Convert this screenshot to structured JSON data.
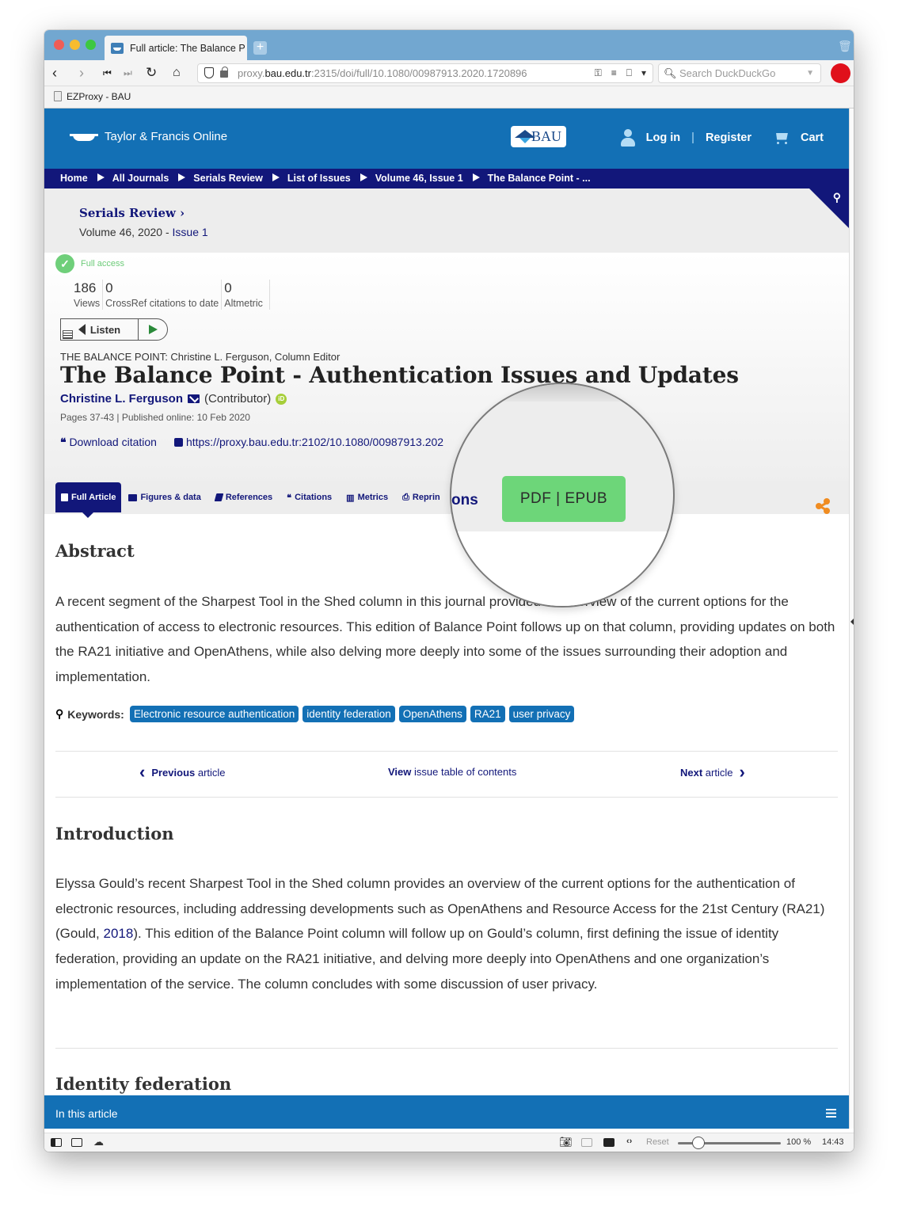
{
  "browser": {
    "tab_title": "Full article: The Balance P",
    "url_prefix": "proxy.",
    "url_domain": "bau.edu.tr",
    "url_rest": ":2315/doi/full/10.1080/00987913.2020.1720896",
    "search_placeholder": "Search DuckDuckGo",
    "bookmark": "EZProxy - BAU",
    "status": {
      "reset_label": "Reset",
      "zoom_level": "100 %",
      "zoom_fraction": 0.1,
      "clock": "14:43"
    }
  },
  "site": {
    "logo_text": "Taylor & Francis Online",
    "institution_logo": "BAU",
    "login": "Log in",
    "separator": "|",
    "register": "Register",
    "cart": "Cart",
    "brand_color": "#1370b5",
    "nav_color": "#12177a"
  },
  "breadcrumbs": [
    "Home",
    "All Journals",
    "Serials Review",
    "List of Issues",
    "Volume 46, Issue 1",
    "The Balance Point - ..."
  ],
  "journal": {
    "title": "Serials Review ›",
    "volume": "Volume 46, 2020 - ",
    "issue": "Issue 1"
  },
  "article": {
    "access": "Full access",
    "metrics": [
      {
        "value": "186",
        "label": "Views"
      },
      {
        "value": "0",
        "label": "CrossRef citations to date"
      },
      {
        "value": "0",
        "label": "Altmetric"
      }
    ],
    "listen_label": "Listen",
    "column_editor": "THE BALANCE POINT: Christine L. Ferguson, Column Editor",
    "title": "The Balance Point - Authentication Issues and Updates",
    "author": "Christine L. Ferguson",
    "author_role": "(Contributor)",
    "orcid_label": "iD",
    "pages_published": "Pages 37-43 | Published online: 10 Feb 2020",
    "download_citation": "Download citation",
    "doi_link": "https://proxy.bau.edu.tr:2102/10.1080/00987913.202",
    "tabs": [
      "Full Article",
      "Figures & data",
      "References",
      "Citations",
      "Metrics",
      "Reprin"
    ],
    "magnified_tab_fragment": "ons",
    "pdf_epub": "PDF | EPUB"
  },
  "abstract": {
    "heading": "Abstract",
    "text": "A recent segment of the Sharpest Tool in the Shed column in this journal provided an overview of the current options for the authentication of access to electronic resources. This edition of Balance Point follows up on that column, providing updates on both the RA21 initiative and OpenAthens, while also delving more deeply into some of the issues surrounding their adoption and implementation."
  },
  "keywords": {
    "label": "Keywords:",
    "items": [
      "Electronic resource authentication",
      "identity federation",
      "OpenAthens",
      "RA21",
      "user privacy"
    ]
  },
  "article_nav": {
    "previous_bold": "Previous",
    "previous_rest": " article",
    "view_bold": "View",
    "view_rest": " issue table of contents",
    "next_bold": "Next",
    "next_rest": " article"
  },
  "introduction": {
    "heading": "Introduction",
    "text_before": "Elyssa Gould’s recent Sharpest Tool in the Shed column provides an overview of the current options for the authentication of electronic resources, including addressing developments such as OpenAthens and Resource Access for the 21st Century (RA21) (Gould, ",
    "citation": "2018",
    "text_after": "). This edition of the Balance Point column will follow up on Gould’s column, first defining the issue of identity federation, providing an update on the RA21 initiative, and delving more deeply into OpenAthens and one organization’s implementation of the service. The column concludes with some discussion of user privacy."
  },
  "next_section": {
    "heading": "Identity federation"
  },
  "in_this_article": "In this article"
}
